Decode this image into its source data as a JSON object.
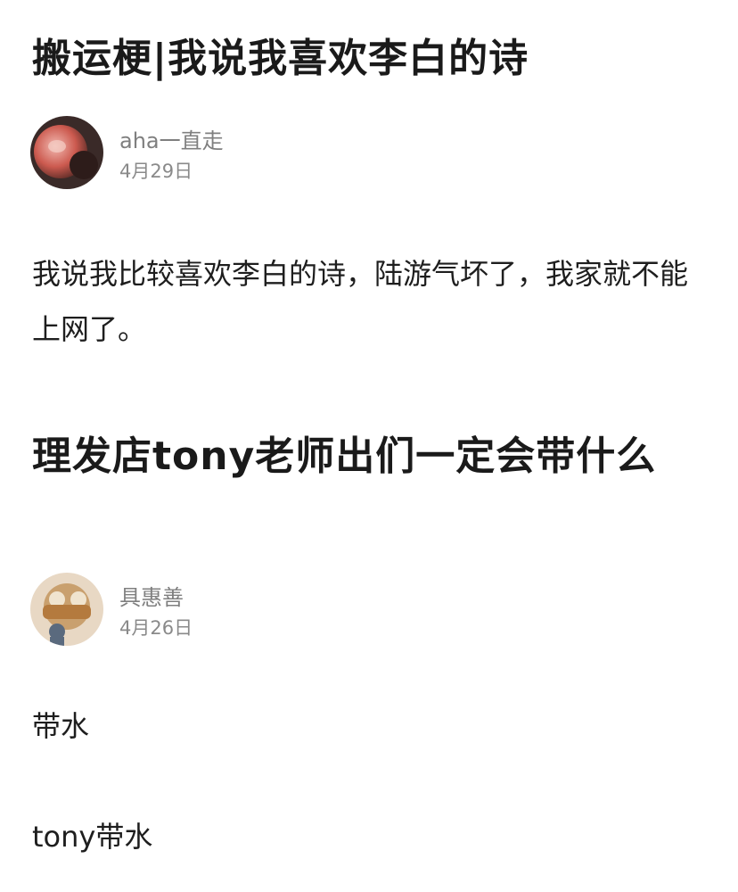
{
  "posts": [
    {
      "title": "搬运梗|我说我喜欢李白的诗",
      "author": "aha一直走",
      "date": "4月29日",
      "body": "我说我比较喜欢李白的诗，陆游气坏了，我家就不能上网了。"
    },
    {
      "title": "理发店tony老师出们一定会带什么",
      "author": "具惠善",
      "date": "4月26日",
      "body_lines": [
        "带水",
        "tony带水"
      ]
    }
  ]
}
